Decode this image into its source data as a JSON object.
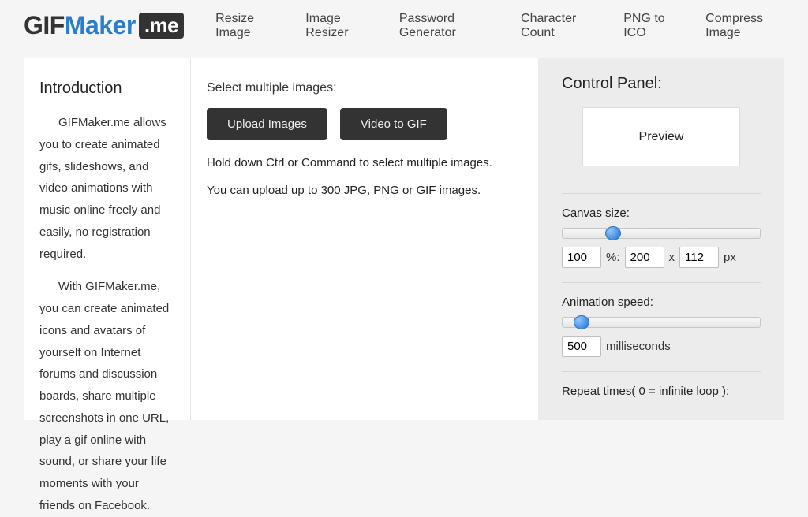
{
  "logo": {
    "p1": "GIF",
    "p2": "Maker",
    "p3": ".me"
  },
  "nav": {
    "n0": "Resize Image",
    "n1": "Image Resizer",
    "n2": "Password Generator",
    "n3": "Character Count",
    "n4": "PNG to ICO",
    "n5": "Compress Image"
  },
  "intro": {
    "heading": "Introduction",
    "p1": "GIFMaker.me allows you to create animated gifs, slideshows, and video animations with music online freely and easily, no registration required.",
    "p2": "With GIFMaker.me, you can create animated icons and avatars of yourself on Internet forums and discussion boards, share multiple screenshots in one URL, play a gif online with sound, or share your life moments with your friends on Facebook."
  },
  "center": {
    "select_label": "Select multiple images:",
    "upload_btn": "Upload Images",
    "video_btn": "Video to GIF",
    "hint1": "Hold down Ctrl or Command to select multiple images.",
    "hint2": "You can upload up to 300 JPG, PNG or GIF images."
  },
  "panel": {
    "title": "Control Panel:",
    "preview": "Preview",
    "canvas_label": "Canvas size:",
    "canvas_pct": "100",
    "pct_sym": "%:",
    "canvas_w": "200",
    "x_sym": "x",
    "canvas_h": "112",
    "px_sym": "px",
    "speed_label": "Animation speed:",
    "speed_val": "500",
    "ms_label": "milliseconds",
    "repeat_label": "Repeat times( 0 = infinite loop ):"
  }
}
